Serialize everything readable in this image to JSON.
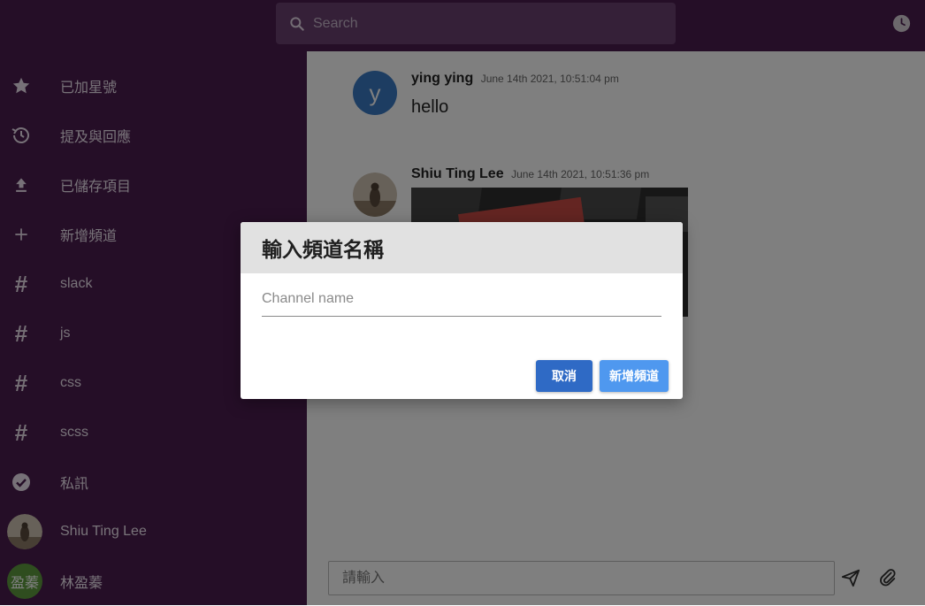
{
  "search": {
    "placeholder": "Search"
  },
  "sidebar": {
    "items": [
      {
        "label": "已加星號",
        "icon": "star-icon"
      },
      {
        "label": "提及與回應",
        "icon": "history-icon"
      },
      {
        "label": "已儲存項目",
        "icon": "upload-icon"
      },
      {
        "label": "新增頻道",
        "icon": "plus-icon"
      },
      {
        "label": "slack",
        "icon": "hash-icon"
      },
      {
        "label": "js",
        "icon": "hash-icon"
      },
      {
        "label": "css",
        "icon": "hash-icon"
      },
      {
        "label": "scss",
        "icon": "hash-icon"
      },
      {
        "label": "私訊",
        "icon": "check-circle-icon"
      }
    ],
    "users": [
      {
        "name": "Shiu Ting Lee",
        "avatar_glyph": ""
      },
      {
        "name": "林盈蓁",
        "avatar_glyph": "盈蓁"
      }
    ]
  },
  "messages": [
    {
      "author": "ying ying",
      "time": "June 14th 2021, 10:51:04 pm",
      "text": "hello",
      "avatar_letter": "y"
    },
    {
      "author": "Shiu Ting Lee",
      "time": "June 14th 2021, 10:51:36 pm",
      "text": ""
    }
  ],
  "composer": {
    "placeholder": "請輸入"
  },
  "modal": {
    "title": "輸入頻道名稱",
    "input_placeholder": "Channel name",
    "cancel_label": "取消",
    "add_label": "新增頻道"
  },
  "colors": {
    "sidebar_bg": "#4a1d4e",
    "primary_button": "#2f6ac5",
    "secondary_button": "#4f98ef",
    "avatar_blue": "#3b7bc4",
    "avatar_green": "#5e9b3f"
  }
}
